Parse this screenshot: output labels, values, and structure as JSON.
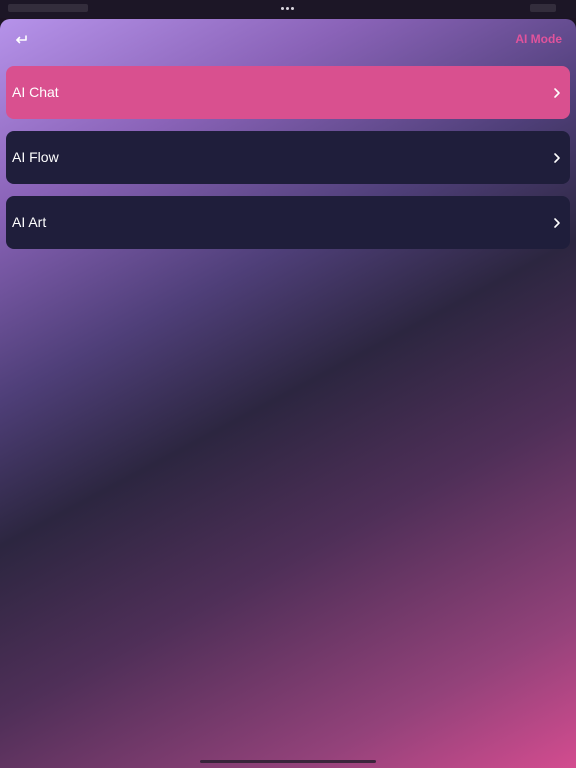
{
  "nav": {
    "back_icon": "return-arrow-icon",
    "title": "AI Mode"
  },
  "menu": {
    "items": [
      {
        "label": "AI Chat",
        "icon": "chevron-right-icon",
        "selected": true
      },
      {
        "label": "AI Flow",
        "icon": "chevron-right-icon",
        "selected": false
      },
      {
        "label": "AI Art",
        "icon": "chevron-right-icon",
        "selected": false
      }
    ]
  },
  "colors": {
    "accent": "#e1539c",
    "selected_row": "#d9508f",
    "row": "#1f1e3b"
  }
}
